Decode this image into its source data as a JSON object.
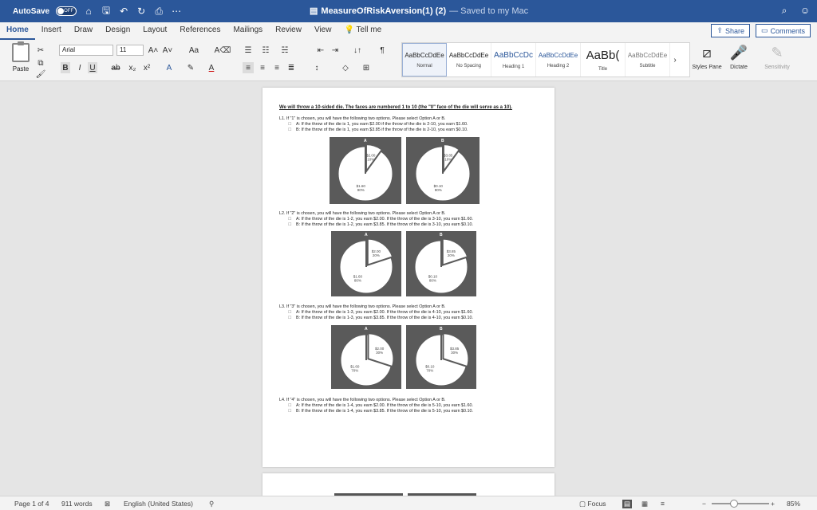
{
  "titlebar": {
    "autosave_label": "AutoSave",
    "autosave_state": "OFF",
    "doc_name": "MeasureOfRiskAversion(1) (2)",
    "save_status": "— Saved to my Mac"
  },
  "tabs": [
    "Home",
    "Insert",
    "Draw",
    "Design",
    "Layout",
    "References",
    "Mailings",
    "Review",
    "View"
  ],
  "tell_me": "Tell me",
  "share_label": "Share",
  "comments_label": "Comments",
  "ribbon": {
    "paste_label": "Paste",
    "font_name": "Arial",
    "font_size": "11",
    "styles": [
      {
        "preview": "AaBbCcDdEe",
        "name": "Normal"
      },
      {
        "preview": "AaBbCcDdEe",
        "name": "No Spacing"
      },
      {
        "preview": "AaBbCcDc",
        "name": "Heading 1"
      },
      {
        "preview": "AaBbCcDdEe",
        "name": "Heading 2"
      },
      {
        "preview": "AaBb(",
        "name": "Title"
      },
      {
        "preview": "AaBbCcDdEe",
        "name": "Subtitle"
      }
    ],
    "styles_pane_label": "Styles Pane",
    "dictate_label": "Dictate",
    "sensitivity_label": "Sensitivity"
  },
  "document": {
    "heading": "We will throw a 10-sided die. The faces are numbered 1 to 10 (the \"0\" face of the die will serve as a 10).",
    "questions": [
      {
        "intro": "L1. If \"1\" is chosen, you will have the following two options. Please select Option A or B.",
        "a": "A: If the throw of the die is 1, you earn $2.00 if the throw of the die is 2-10, you earn $1.60.",
        "b": "B: If the throw of the die is 1, you earn $3.85 if the throw of the die is 2-10, you earn $0.10.",
        "pieA": [
          {
            "label": "$2.00",
            "pct": "10%"
          },
          {
            "label": "$1.60",
            "pct": "90%"
          }
        ],
        "pieB": [
          {
            "label": "$3.85",
            "pct": "10%"
          },
          {
            "label": "$0.10",
            "pct": "90%"
          }
        ],
        "fracA": 0.1,
        "fracB": 0.1
      },
      {
        "intro": "L2. If \"2\" is chosen, you will have the following two options. Please select Option A or B.",
        "a": "A: If the throw of the die is 1-2, you earn $2.00. If the throw of the die is 3-10, you earn $1.60.",
        "b": "B: If the throw of the die is 1-2, you earn $3.85. If the throw of the die is 3-10, you earn $0.10.",
        "pieA": [
          {
            "label": "$2.00",
            "pct": "20%"
          },
          {
            "label": "$1.60",
            "pct": "80%"
          }
        ],
        "pieB": [
          {
            "label": "$3.85",
            "pct": "20%"
          },
          {
            "label": "$0.10",
            "pct": "80%"
          }
        ],
        "fracA": 0.2,
        "fracB": 0.2
      },
      {
        "intro": "L3. If \"3\" is chosen, you will have the following two options. Please select Option A or B.",
        "a": "A: If the throw of the die is 1-3, you earn $2.00. If the throw of the die is 4-10, you earn $1.60.",
        "b": "B: If the throw of the die is 1-3, you earn $3.85. If the throw of the die is 4-10, you earn $0.10.",
        "pieA": [
          {
            "label": "$2.00",
            "pct": "30%"
          },
          {
            "label": "$1.60",
            "pct": "70%"
          }
        ],
        "pieB": [
          {
            "label": "$3.85",
            "pct": "30%"
          },
          {
            "label": "$0.10",
            "pct": "70%"
          }
        ],
        "fracA": 0.3,
        "fracB": 0.3
      },
      {
        "intro": "L4. If \"4\" is chosen, you will have the following two options. Please select Option A or B.",
        "a": "A: If the throw of the die is 1-4, you earn $2.00. If the throw of the die is 5-10, you earn $1.60.",
        "b": "B: If the throw of the die is 1-4, you earn $3.85. If the throw of the die is 5-10, you earn $0.10."
      }
    ],
    "option_a_title": "A",
    "option_b_title": "B"
  },
  "status": {
    "page": "Page 1 of 4",
    "words": "911 words",
    "language": "English (United States)",
    "focus": "Focus",
    "zoom": "85%"
  },
  "colors": {
    "brand": "#2b579a",
    "panel": "#5a5a5a"
  }
}
